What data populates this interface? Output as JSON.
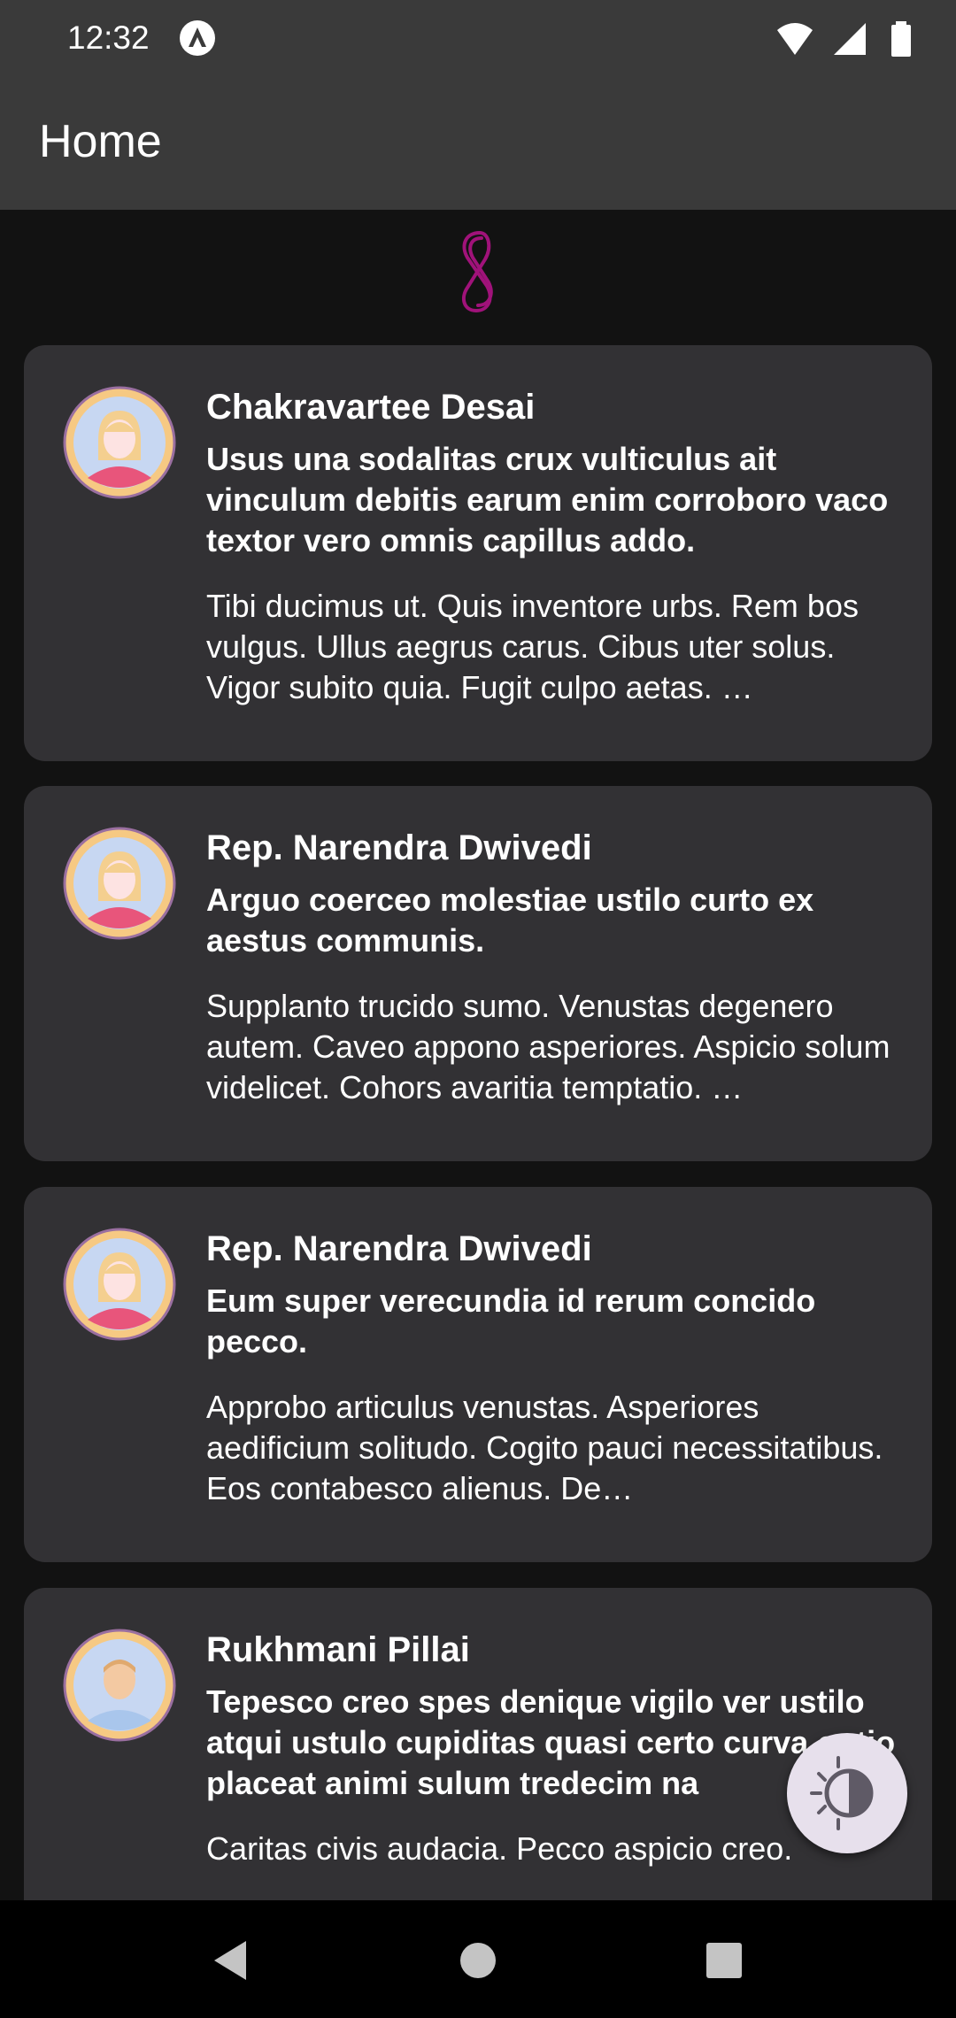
{
  "status_bar": {
    "time": "12:32"
  },
  "app_bar": {
    "title": "Home"
  },
  "posts": [
    {
      "author": "Chakravartee Desai",
      "headline": "Usus una sodalitas crux vulticulus ait vinculum debitis earum enim corroboro vaco textor vero omnis capillus addo.",
      "body": "Tibi ducimus ut. Quis inventore urbs. Rem bos vulgus. Ullus aegrus carus. Cibus uter solus. Vigor subito quia. Fugit culpo aetas. …",
      "avatar": "female-avatar-icon"
    },
    {
      "author": "Rep. Narendra Dwivedi",
      "headline": "Arguo coerceo molestiae ustilo curto ex aestus communis.",
      "body": "Supplanto trucido sumo. Venustas degenero autem. Caveo appono asperiores. Aspicio solum videlicet. Cohors avaritia temptatio. …",
      "avatar": "female-avatar-icon"
    },
    {
      "author": "Rep. Narendra Dwivedi",
      "headline": "Eum super verecundia id rerum concido pecco.",
      "body": "Approbo articulus venustas. Asperiores aedificium solitudo. Cogito pauci necessitatibus. Eos contabesco alienus. De…",
      "avatar": "female-avatar-icon"
    },
    {
      "author": "Rukhmani Pillai",
      "headline": "Tepesco creo spes denique vigilo ver ustilo atqui ustulo cupiditas quasi certo curva optio placeat animi sulum tredecim na",
      "body": "Caritas civis audacia. Pecco aspicio creo.",
      "avatar": "male-avatar-icon"
    }
  ],
  "colors": {
    "bars": "#3a3a3a",
    "background": "#121212",
    "card": "#323134",
    "logo": "#a0127a",
    "fab": "#e7e0ec"
  }
}
